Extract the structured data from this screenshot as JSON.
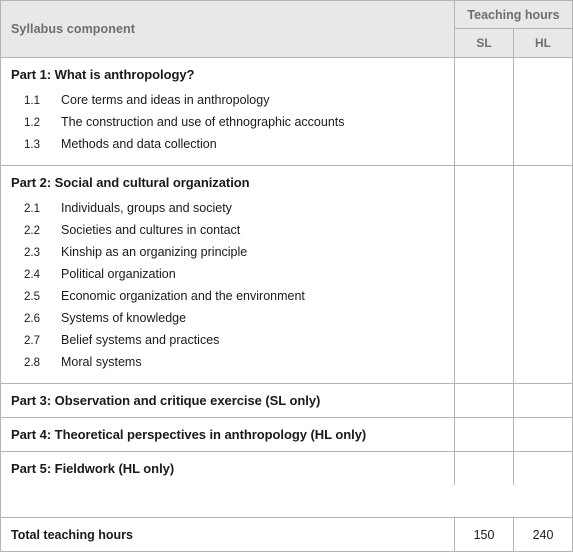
{
  "table": {
    "header": {
      "component_label": "Syllabus component",
      "teaching_hours_label": "Teaching hours",
      "sl_label": "SL",
      "hl_label": "HL"
    },
    "parts": [
      {
        "heading": "Part 1: What is anthropology?",
        "sl": "",
        "hl": "",
        "items": [
          {
            "num": "1.1",
            "text": "Core terms and ideas in anthropology"
          },
          {
            "num": "1.2",
            "text": "The construction and use of ethnographic accounts"
          },
          {
            "num": "1.3",
            "text": "Methods and data collection"
          }
        ]
      },
      {
        "heading": "Part 2: Social and cultural organization",
        "sl": "",
        "hl": "",
        "items": [
          {
            "num": "2.1",
            "text": "Individuals, groups and society"
          },
          {
            "num": "2.2",
            "text": "Societies and cultures in contact"
          },
          {
            "num": "2.3",
            "text": "Kinship as an organizing principle"
          },
          {
            "num": "2.4",
            "text": "Political organization"
          },
          {
            "num": "2.5",
            "text": "Economic organization and the environment"
          },
          {
            "num": "2.6",
            "text": "Systems of knowledge"
          },
          {
            "num": "2.7",
            "text": "Belief systems and practices"
          },
          {
            "num": "2.8",
            "text": "Moral systems"
          }
        ]
      },
      {
        "heading": "Part 3: Observation and critique exercise (SL only)",
        "sl": "",
        "hl": "",
        "items": []
      },
      {
        "heading": "Part 4: Theoretical perspectives in anthropology (HL only)",
        "sl": "",
        "hl": "",
        "items": []
      },
      {
        "heading": "Part 5: Fieldwork (HL only)",
        "sl": "",
        "hl": "",
        "items": []
      }
    ],
    "total": {
      "label": "Total teaching hours",
      "sl": "150",
      "hl": "240"
    }
  },
  "colors": {
    "header_background": "#e8e8e8",
    "border": "#b4b4b4",
    "header_text": "#6e6e6e",
    "body_text": "#1a1a1a"
  }
}
